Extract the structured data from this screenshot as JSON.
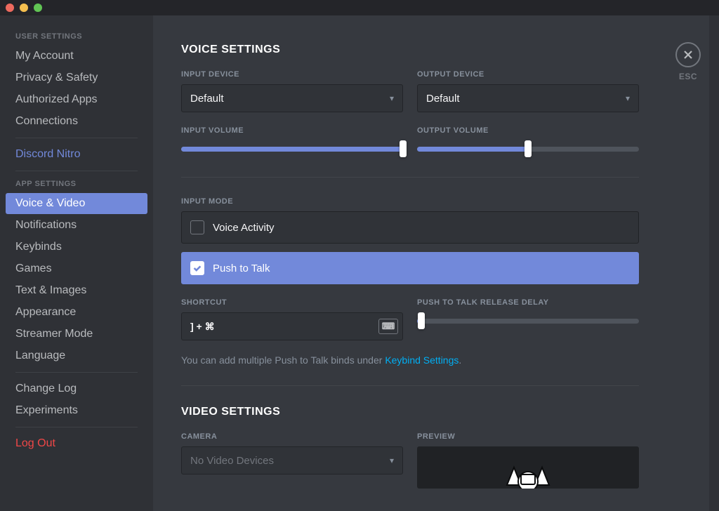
{
  "escLabel": "ESC",
  "sidebar": {
    "userHeader": "USER SETTINGS",
    "appHeader": "APP SETTINGS",
    "items": {
      "myAccount": "My Account",
      "privacy": "Privacy & Safety",
      "authorizedApps": "Authorized Apps",
      "connections": "Connections",
      "nitro": "Discord Nitro",
      "voiceVideo": "Voice & Video",
      "notifications": "Notifications",
      "keybinds": "Keybinds",
      "games": "Games",
      "textImages": "Text & Images",
      "appearance": "Appearance",
      "streamer": "Streamer Mode",
      "language": "Language",
      "changeLog": "Change Log",
      "experiments": "Experiments",
      "logout": "Log Out"
    }
  },
  "voice": {
    "title": "VOICE SETTINGS",
    "inputDeviceLabel": "INPUT DEVICE",
    "inputDeviceValue": "Default",
    "outputDeviceLabel": "OUTPUT DEVICE",
    "outputDeviceValue": "Default",
    "inputVolumeLabel": "INPUT VOLUME",
    "inputVolumePercent": 100,
    "outputVolumeLabel": "OUTPUT VOLUME",
    "outputVolumePercent": 50,
    "inputModeLabel": "INPUT MODE",
    "voiceActivity": "Voice Activity",
    "pushToTalk": "Push to Talk",
    "shortcutLabel": "SHORTCUT",
    "shortcutValue": "] + ⌘",
    "releaseDelayLabel": "PUSH TO TALK RELEASE DELAY",
    "releaseDelayPercent": 2,
    "hintPrefix": "You can add multiple Push to Talk binds under ",
    "hintLink": "Keybind Settings",
    "hintSuffix": "."
  },
  "video": {
    "title": "VIDEO SETTINGS",
    "cameraLabel": "CAMERA",
    "cameraValue": "No Video Devices",
    "previewLabel": "PREVIEW"
  }
}
